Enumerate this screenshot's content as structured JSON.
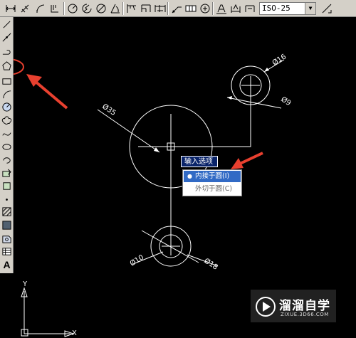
{
  "toolbar": {
    "dimension_style": "ISO-25",
    "buttons": [
      "dim-linear-icon",
      "dim-aligned-icon",
      "dim-arc-icon",
      "dim-ordinate-icon",
      "dim-radius-icon",
      "dim-jogged-icon",
      "dim-diameter-icon",
      "dim-angular-icon",
      "quick-dim-icon",
      "dim-baseline-icon",
      "dim-continue-icon",
      "qleader-icon",
      "tolerance-icon",
      "center-mark-icon",
      "dim-edit-icon",
      "dim-text-edit-icon",
      "dim-update-icon",
      "dim-style-icon"
    ]
  },
  "left_toolbar": {
    "buttons": [
      "line-icon",
      "construction-line-icon",
      "polyline-icon",
      "polygon-icon",
      "rectangle-icon",
      "arc-icon",
      "circle-icon",
      "revision-cloud-icon",
      "spline-icon",
      "ellipse-icon",
      "ellipse-arc-icon",
      "insert-block-icon",
      "make-block-icon",
      "point-icon",
      "hatch-icon",
      "gradient-icon",
      "region-icon",
      "table-icon",
      "multiline-text-icon"
    ],
    "text_label": "A"
  },
  "drawing": {
    "dimensions": {
      "big_circle": "Ø35",
      "small_top_outer": "Ø16",
      "small_top_inner": "Ø9",
      "small_bottom_inner": "Ø10",
      "small_bottom_outer": "Ø18"
    },
    "ucs": {
      "x_label": "X",
      "y_label": "Y"
    }
  },
  "popup": {
    "title": "输入选项",
    "items": [
      {
        "label": "内接于圆(I)",
        "selected": true
      },
      {
        "label": "外切于圆(C)",
        "selected": false
      }
    ]
  },
  "watermark": {
    "brand": "溜溜自学",
    "url": "ZIXUE.3D66.COM"
  },
  "colors": {
    "annotation_red": "#e8402f",
    "highlight_blue": "#316ac5",
    "title_blue": "#0a246a"
  }
}
